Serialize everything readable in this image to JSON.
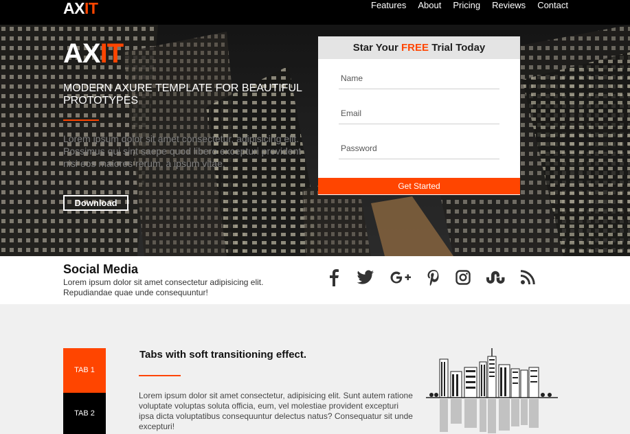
{
  "brand": {
    "prefix": "AX",
    "suffix": "IT"
  },
  "nav": {
    "items": [
      "Features",
      "About",
      "Pricing",
      "Reviews",
      "Contact"
    ]
  },
  "hero": {
    "tagline": "MODERN AXURE TEMPLATE FOR BEAUTIFUL PROTOTYPES",
    "text": "Lorem ipsum dolor sit amet consectetur, adipisicing elit. Possimus qui sint saepe quod libero excepturi provident nisi eos maiores rerum, a ipsum vitae.",
    "download_label": "Download"
  },
  "form": {
    "title_start": "Star Your ",
    "title_highlight": "FREE",
    "title_end": " Trial Today",
    "name_placeholder": "Name",
    "email_placeholder": "Email",
    "password_placeholder": "Password",
    "submit_label": "Get Started"
  },
  "social": {
    "title": "Social Media",
    "text": "Lorem ipsum dolor sit amet consectetur adipisicing elit. Repudiandae quae unde consequuntur!",
    "icons": [
      "facebook-icon",
      "twitter-icon",
      "google-plus-icon",
      "pinterest-icon",
      "instagram-icon",
      "stumbleupon-icon",
      "rss-icon"
    ]
  },
  "tabs": {
    "items": [
      "TAB 1",
      "TAB 2"
    ],
    "title": "Tabs with soft transitioning effect.",
    "text": "Lorem ipsum dolor sit amet consectetur, adipisicing elit. Sunt autem ratione voluptate voluptas soluta officia, eum, vel molestiae provident excepturi ipsa dicta voluptatibus consequuntur delectus natus? Consequatur sit unde excepturi!"
  },
  "colors": {
    "accent": "#ff4500",
    "dark": "#000000"
  }
}
